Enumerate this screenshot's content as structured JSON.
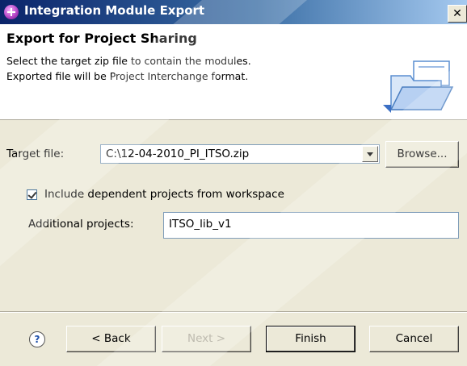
{
  "window": {
    "title": "Integration Module Export",
    "close_glyph": "✕"
  },
  "header": {
    "title": "Export for Project Sharing",
    "line1": "Select the target zip file to contain the modules.",
    "line2": "Exported file will be Project Interchange format.",
    "icon": "folder-export-icon"
  },
  "form": {
    "target_label": "Target file:",
    "target_value": "C:\\12-04-2010_PI_ITSO.zip",
    "browse_label": "Browse...",
    "include_label": "Include dependent projects from workspace",
    "include_checked": true,
    "additional_label": "Additional projects:",
    "additional_value": "ITSO_lib_v1"
  },
  "footer": {
    "help_glyph": "?",
    "back_label": "< Back",
    "next_label": "Next >",
    "finish_label": "Finish",
    "cancel_label": "Cancel"
  },
  "colors": {
    "titlebar_start": "#0a246a",
    "titlebar_end": "#a6caf0",
    "dialog_bg": "#ece9d8",
    "header_bg": "#ffffff"
  }
}
